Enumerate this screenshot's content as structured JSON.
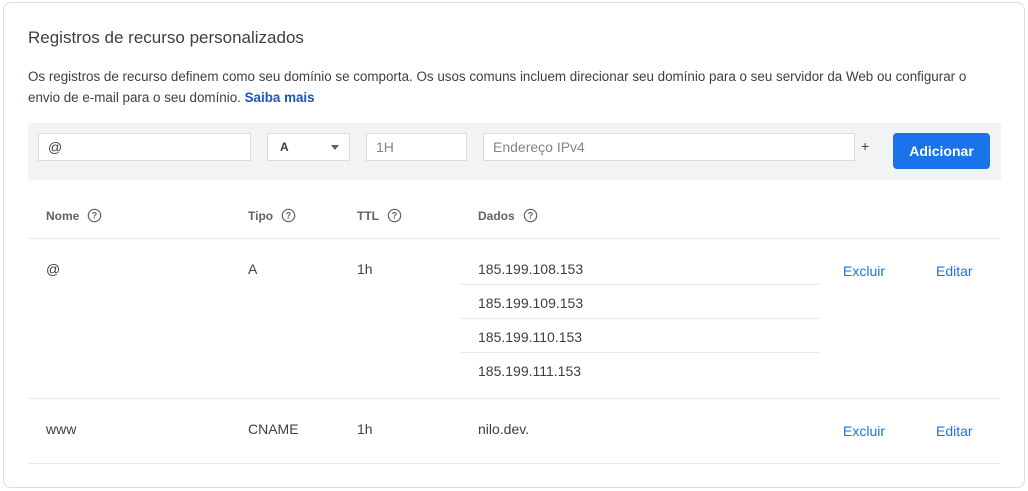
{
  "section": {
    "title": "Registros de recurso personalizados",
    "description": "Os registros de recurso definem como seu domínio se comporta. Os usos comuns incluem direcionar seu domínio para o seu servidor da Web ou configurar o envio de e-mail para o seu domínio.",
    "learn_more": "Saiba mais"
  },
  "add_form": {
    "name_value": "@",
    "type_value": "A",
    "ttl_placeholder": "1H",
    "data_placeholder": "Endereço IPv4",
    "plus_label": "+",
    "add_label": "Adicionar"
  },
  "table": {
    "headers": {
      "name": "Nome",
      "type": "Tipo",
      "ttl": "TTL",
      "data": "Dados"
    },
    "rows": [
      {
        "name": "@",
        "type": "A",
        "ttl": "1h",
        "data": [
          "185.199.108.153",
          "185.199.109.153",
          "185.199.110.153",
          "185.199.111.153"
        ],
        "delete_label": "Excluir",
        "edit_label": "Editar"
      },
      {
        "name": "www",
        "type": "CNAME",
        "ttl": "1h",
        "data": [
          "nilo.dev."
        ],
        "delete_label": "Excluir",
        "edit_label": "Editar"
      }
    ]
  },
  "icons": {
    "help": "help-circle-icon",
    "dropdown": "chevron-down-icon"
  },
  "colors": {
    "primary": "#1a73e8",
    "link": "#1a57b8",
    "text": "#3c4043",
    "muted": "#5f6368",
    "form_bg": "#f1f3f4",
    "divider": "#e8eaed"
  }
}
